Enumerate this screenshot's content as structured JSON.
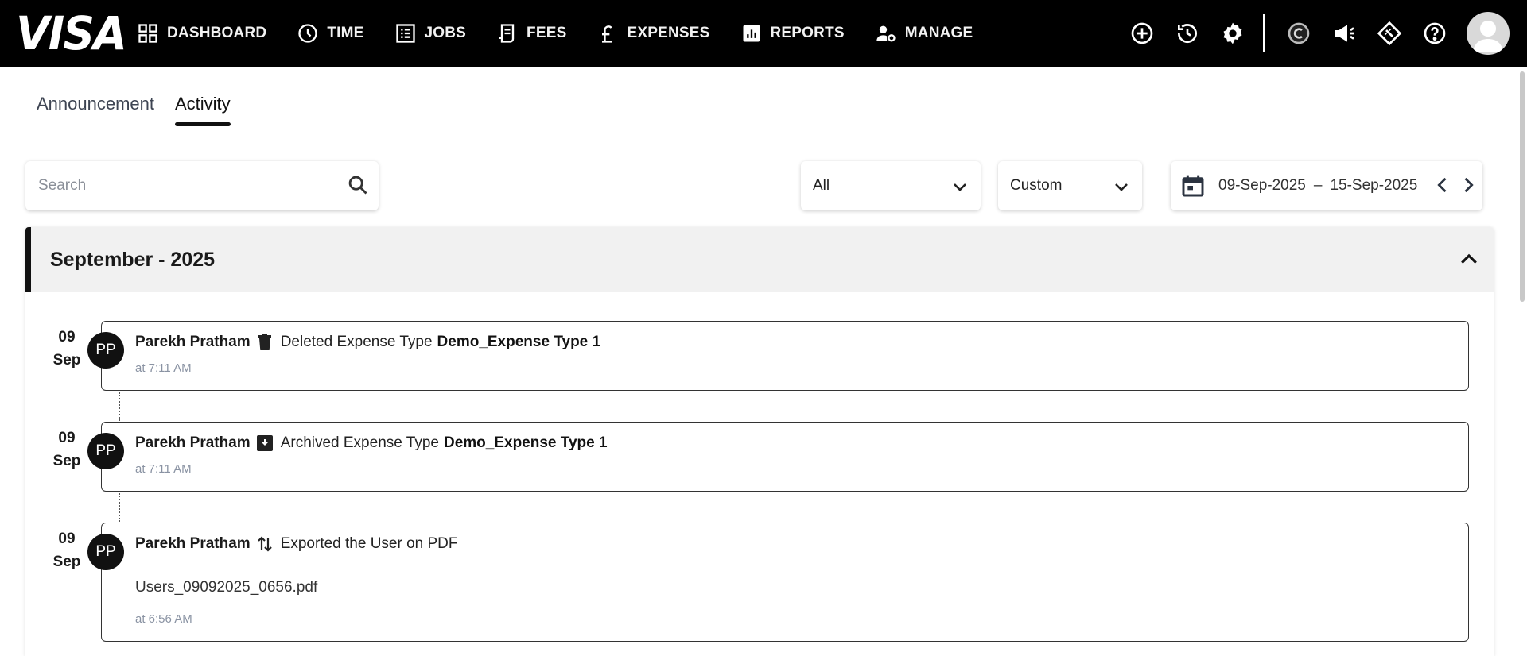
{
  "brand": {
    "logo_text": "VISA"
  },
  "nav": {
    "items": [
      {
        "label": "DASHBOARD",
        "icon": "dashboard-icon"
      },
      {
        "label": "TIME",
        "icon": "clock-icon"
      },
      {
        "label": "JOBS",
        "icon": "jobs-icon"
      },
      {
        "label": "FEES",
        "icon": "fees-icon"
      },
      {
        "label": "EXPENSES",
        "icon": "pound-icon"
      },
      {
        "label": "REPORTS",
        "icon": "reports-icon"
      },
      {
        "label": "MANAGE",
        "icon": "manage-icon"
      }
    ]
  },
  "topbar_icons": [
    "add-circle-icon",
    "history-icon",
    "settings-icon",
    "copyright-icon",
    "announcement-icon",
    "ticket-icon",
    "help-icon",
    "user-avatar-icon"
  ],
  "tabs": [
    {
      "label": "Announcement",
      "active": false
    },
    {
      "label": "Activity",
      "active": true
    }
  ],
  "search": {
    "placeholder": "Search",
    "value": ""
  },
  "filters": {
    "type_select": "All",
    "period_select": "Custom",
    "date_from": "09-Sep-2025",
    "date_sep": "–",
    "date_to": "15-Sep-2025"
  },
  "group": {
    "title": "September - 2025",
    "expanded": true
  },
  "activities": [
    {
      "day": "09",
      "month": "Sep",
      "initials": "PP",
      "user": "Parekh Pratham",
      "icon": "delete-icon",
      "action": "Deleted Expense Type",
      "target": "Demo_Expense Type 1",
      "file": "",
      "time": "at 7:11 AM"
    },
    {
      "day": "09",
      "month": "Sep",
      "initials": "PP",
      "user": "Parekh Pratham",
      "icon": "archive-icon",
      "action": "Archived Expense Type",
      "target": "Demo_Expense Type 1",
      "file": "",
      "time": "at 7:11 AM"
    },
    {
      "day": "09",
      "month": "Sep",
      "initials": "PP",
      "user": "Parekh Pratham",
      "icon": "export-icon",
      "action": "Exported the User on PDF",
      "target": "",
      "file": "Users_09092025_0656.pdf",
      "time": "at 6:56 AM"
    }
  ],
  "colors": {
    "topbar_bg": "#000000",
    "accent": "#111111",
    "group_header_bg": "#f1f1f1",
    "time_text": "#8a93a3"
  }
}
